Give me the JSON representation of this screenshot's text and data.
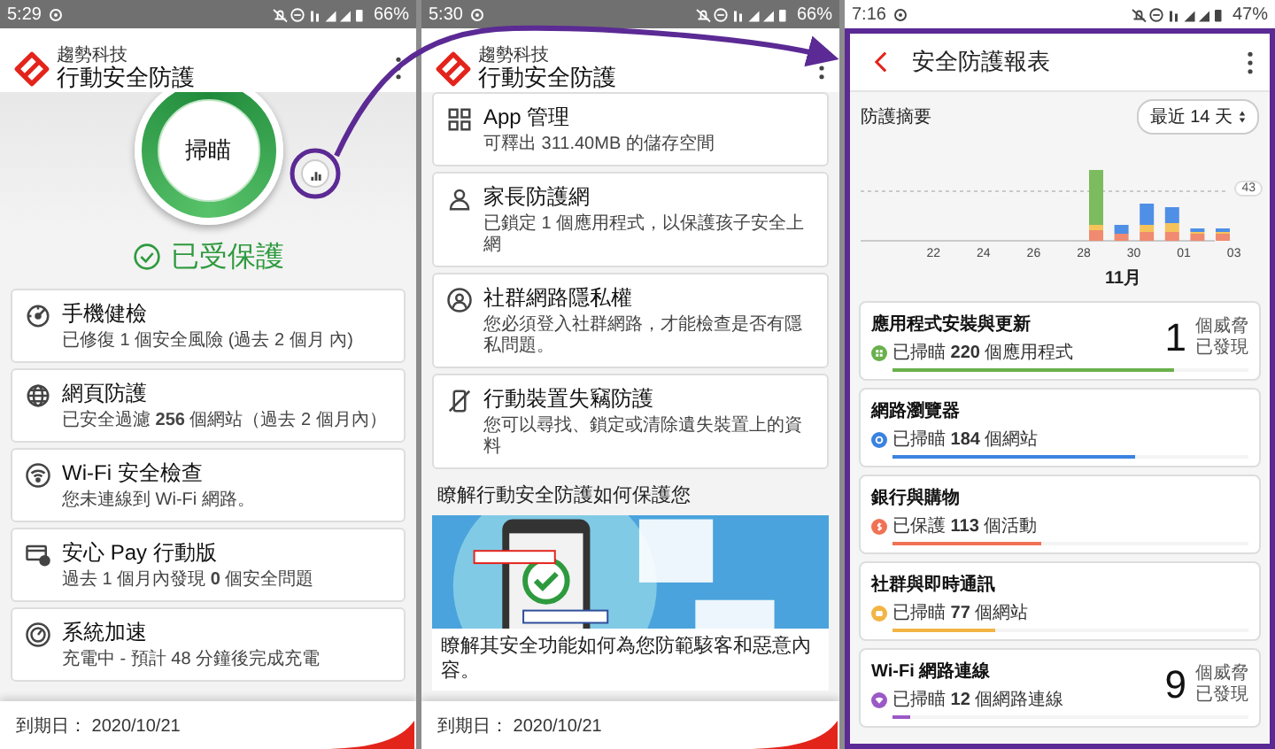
{
  "phones": [
    {
      "kind": "home",
      "status_bar": {
        "time": "5:29",
        "battery": "66%"
      },
      "app_header": {
        "brand": "趨勢科技",
        "title": "行動安全防護"
      },
      "scan_button": {
        "label": "掃瞄"
      },
      "protection_status": "已受保護",
      "features": [
        {
          "title": "手機健檢",
          "detail": "已修復 1 個安全風險 (過去 2 個月 內)"
        },
        {
          "title": "網頁防護",
          "detail": "已安全過濾 **256** 個網站（過去 2 個月內）"
        },
        {
          "title": "Wi-Fi 安全檢查",
          "detail": "您未連線到 Wi-Fi 網路。"
        },
        {
          "title": "安心 Pay 行動版",
          "detail": "過去 1 個月內發現 **0** 個安全問題"
        },
        {
          "title": "系統加速",
          "detail": "充電中 - 預計 48 分鐘後完成充電"
        }
      ],
      "footer": "到期日： 2020/10/21"
    },
    {
      "kind": "features",
      "status_bar": {
        "time": "5:30",
        "battery": "66%"
      },
      "app_header": {
        "brand": "趨勢科技",
        "title": "行動安全防護"
      },
      "features": [
        {
          "title": "App 管理",
          "detail": "可釋出 311.40MB 的儲存空間"
        },
        {
          "title": "家長防護網",
          "detail": "已鎖定 1 個應用程式，以保護孩子安全上網"
        },
        {
          "title": "社群網路隱私權",
          "detail": "您必須登入社群網路，才能檢查是否有隱私問題。"
        },
        {
          "title": "行動裝置失竊防護",
          "detail": "您可以尋找、鎖定或清除遺失裝置上的資料"
        }
      ],
      "learn_section": {
        "heading": "瞭解行動安全防護如何保護您",
        "caption": "瞭解其安全功能如何為您防範駭客和惡意內容。"
      },
      "footer": "到期日： 2020/10/21"
    },
    {
      "kind": "report",
      "status_bar": {
        "time": "7:16",
        "battery": "47%"
      },
      "report_header": {
        "title": "安全防護報表"
      },
      "summary": {
        "title": "防護摘要",
        "range": "最近 14 天",
        "x_labels": [
          "22",
          "24",
          "26",
          "28",
          "30",
          "01",
          "03"
        ],
        "month": "11月",
        "reference": "43"
      },
      "categories": [
        {
          "title": "應用程式安裝與更新",
          "detail": "已掃瞄 **220** 個應用程式",
          "color": "#6ab04c",
          "level": 0.79,
          "count": "1",
          "count_label": "個威脅",
          "count_note": "已發現"
        },
        {
          "title": "網路瀏覽器",
          "detail": "已掃瞄 **184** 個網站",
          "color": "#3b82e0",
          "level": 0.68
        },
        {
          "title": "銀行與購物",
          "detail": "已保護 **113** 個活動",
          "color": "#f07255",
          "level": 0.42
        },
        {
          "title": "社群與即時通訊",
          "detail": "已掃瞄 **77** 個網站",
          "color": "#f3b443",
          "level": 0.29
        },
        {
          "title": "Wi-Fi 網路連線",
          "detail": "已掃瞄 **12** 個網路連線",
          "color": "#9b59c6",
          "level": 0.05,
          "count": "9",
          "count_label": "個威脅",
          "count_note": "已發現"
        }
      ]
    }
  ]
}
